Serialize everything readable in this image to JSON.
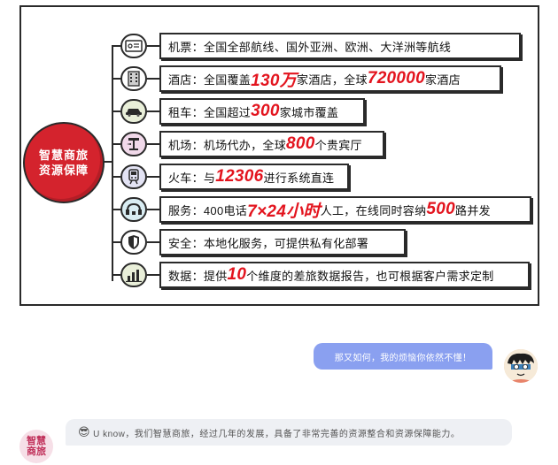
{
  "infographic": {
    "hub_line1": "智慧商旅",
    "hub_line2": "资源保障",
    "items": [
      {
        "icon": "ticket-icon",
        "pre": "机票：全国全部航线、国外亚洲、欧洲、大洋洲等航线",
        "hl": "",
        "post": ""
      },
      {
        "icon": "hotel-icon",
        "pre": "酒店：全国覆盖",
        "hl": "130万",
        "post": "家酒店，全球",
        "hl2": "720000",
        "post2": "家酒店"
      },
      {
        "icon": "car-icon",
        "pre": "租车：全国超过",
        "hl": "300",
        "post": "家城市覆盖"
      },
      {
        "icon": "airport-icon",
        "pre": "机场：机场代办，全球",
        "hl": "800",
        "post": "个贵宾厅"
      },
      {
        "icon": "train-icon",
        "pre": "火车：与",
        "hl": "12306",
        "post": "进行系统直连"
      },
      {
        "icon": "service-icon",
        "pre": "服务：400电话",
        "hl": "7×24小时",
        "post": "人工，在线同时容纳",
        "hl2": "500",
        "post2": "路并发"
      },
      {
        "icon": "shield-icon",
        "pre": "安全：本地化服务，可提供私有化部署",
        "hl": "",
        "post": ""
      },
      {
        "icon": "bar-chart-icon",
        "pre": "数据：提供",
        "hl": "10",
        "post": "个维度的差旅数据报告，也可根据客户需求定制"
      }
    ]
  },
  "chat": {
    "user_message": "那又如何，我的烦恼你依然不懂！",
    "bot_emoji": "😎",
    "bot_message": "U know，我们智慧商旅，经过几年的发展，具备了非常完善的资源整合和资源保障能力。",
    "bot_avatar_line1": "智慧",
    "bot_avatar_line2": "商旅"
  }
}
